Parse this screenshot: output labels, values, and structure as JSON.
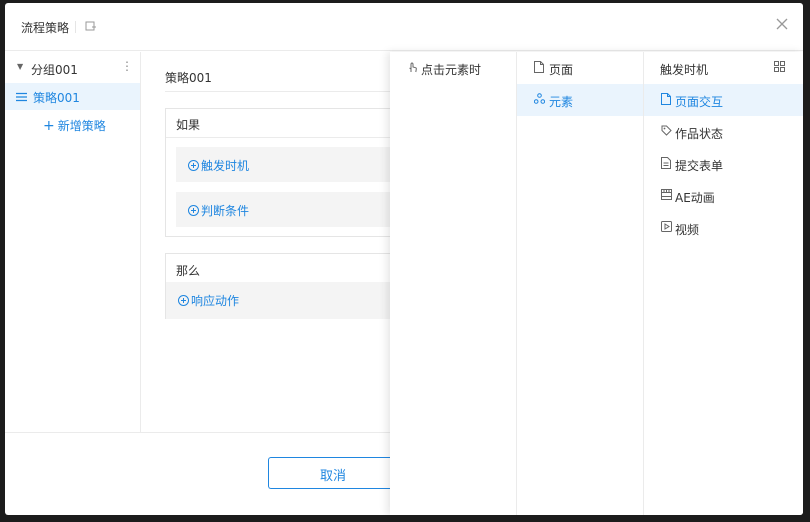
{
  "modal": {
    "title": "流程策略"
  },
  "sidebar": {
    "group_label": "分组001",
    "strategy_label": "策略001",
    "add_label": "新增策略"
  },
  "main": {
    "strategy_name": "策略001",
    "if_label": "如果",
    "trigger_label": "触发时机",
    "condition_label": "判断条件",
    "then_label": "那么",
    "action_label": "响应动作"
  },
  "footer": {
    "cancel_label": "取消"
  },
  "panel": {
    "col1": [
      {
        "label": "点击元素时",
        "icon": "tap-icon"
      }
    ],
    "col2": [
      {
        "label": "页面",
        "icon": "page-icon"
      },
      {
        "label": "元素",
        "icon": "element-icon",
        "active": true
      }
    ],
    "col3_title": "触发时机",
    "col3": [
      {
        "label": "页面交互",
        "icon": "page-icon",
        "active": true
      },
      {
        "label": "作品状态",
        "icon": "tag-icon"
      },
      {
        "label": "提交表单",
        "icon": "form-icon"
      },
      {
        "label": "AE动画",
        "icon": "film-icon"
      },
      {
        "label": "视频",
        "icon": "video-icon"
      }
    ]
  },
  "colors": {
    "accent": "#1f86e0",
    "active_bg": "#eaf4fd"
  }
}
